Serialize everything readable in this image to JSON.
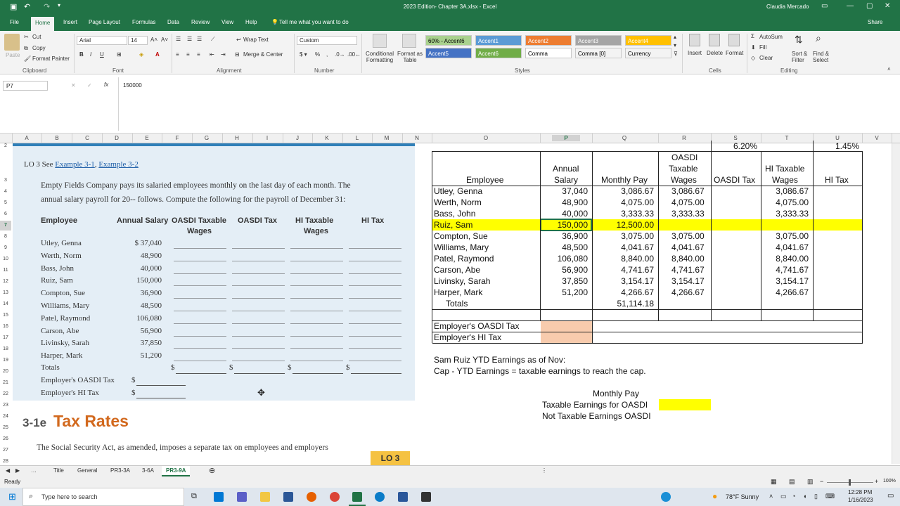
{
  "window": {
    "title": "2023 Edition- Chapter 3A.xlsx  -  Excel",
    "user": "Claudia Mercado"
  },
  "ribbon_tabs": [
    "File",
    "Home",
    "Insert",
    "Page Layout",
    "Formulas",
    "Data",
    "Review",
    "View",
    "Help",
    "Tell me what you want to do"
  ],
  "share_label": "Share",
  "ribbon": {
    "clipboard": {
      "paste": "Paste",
      "cut": "Cut",
      "copy": "Copy",
      "format_painter": "Format Painter",
      "label": "Clipboard"
    },
    "font": {
      "name": "Arial",
      "size": "14",
      "label": "Font"
    },
    "alignment": {
      "wrap": "Wrap Text",
      "merge": "Merge & Center",
      "label": "Alignment"
    },
    "number": {
      "format": "Custom",
      "label": "Number"
    },
    "styles": {
      "conditional": "Conditional Formatting",
      "format_table": "Format as Table",
      "chips": [
        {
          "label": "60% - Accent6",
          "bg": "#a9d18e",
          "fg": "#000000"
        },
        {
          "label": "Accent1",
          "bg": "#5b9bd5",
          "fg": "#ffffff"
        },
        {
          "label": "Accent2",
          "bg": "#ed7d31",
          "fg": "#ffffff"
        },
        {
          "label": "Accent3",
          "bg": "#a5a5a5",
          "fg": "#ffffff"
        },
        {
          "label": "Accent4",
          "bg": "#ffc000",
          "fg": "#ffffff"
        },
        {
          "label": "Accent5",
          "bg": "#4472c4",
          "fg": "#ffffff"
        },
        {
          "label": "Accent6",
          "bg": "#70ad47",
          "fg": "#ffffff"
        },
        {
          "label": "Comma",
          "bg": "#ffffff",
          "fg": "#000000"
        },
        {
          "label": "Comma [0]",
          "bg": "#f3f3f3",
          "fg": "#000000"
        },
        {
          "label": "Currency",
          "bg": "#f3f3f3",
          "fg": "#000000"
        }
      ],
      "label": "Styles"
    },
    "cells": {
      "insert": "Insert",
      "delete": "Delete",
      "format": "Format",
      "label": "Cells"
    },
    "editing": {
      "autosum": "AutoSum",
      "fill": "Fill",
      "clear": "Clear",
      "sort": "Sort & Filter",
      "find": "Find & Select",
      "label": "Editing"
    }
  },
  "formula_bar": {
    "name_box": "P7",
    "value": "150000"
  },
  "columns_left": [
    "A",
    "B",
    "C",
    "D",
    "E",
    "F",
    "G",
    "H",
    "I",
    "J",
    "K",
    "L",
    "M",
    "N"
  ],
  "columns_right": [
    "O",
    "P",
    "Q",
    "R",
    "S",
    "T",
    "U",
    "V"
  ],
  "rows": [
    "2",
    "3",
    "4",
    "5",
    "6",
    "7",
    "8",
    "9",
    "10",
    "11",
    "12",
    "13",
    "14",
    "15",
    "16",
    "17",
    "18",
    "19",
    "20",
    "21",
    "22",
    "23",
    "24",
    "25",
    "26",
    "27",
    "28"
  ],
  "book": {
    "lo_prefix": "LO 3  See ",
    "link1": "Example 3-1",
    "comma": ", ",
    "link2": "Example 3-2",
    "para1": "Empty Fields Company pays its salaried employees monthly on the last day of each month. The",
    "para2": "annual salary payroll for 20-- follows. Compute the following for the payroll of December 31:",
    "headers": {
      "employee": "Employee",
      "annual": "Annual Salary",
      "oasdi_wages1": "OASDI Taxable",
      "oasdi_wages2": "Wages",
      "oasdi_tax": "OASDI Tax",
      "hi_wages1": "HI Taxable",
      "hi_wages2": "Wages",
      "hi_tax": "HI Tax"
    },
    "employees": [
      {
        "name": "Utley, Genna",
        "salary": "$ 37,040"
      },
      {
        "name": "Werth, Norm",
        "salary": "48,900"
      },
      {
        "name": "Bass, John",
        "salary": "40,000"
      },
      {
        "name": "Ruiz, Sam",
        "salary": "150,000"
      },
      {
        "name": "Compton, Sue",
        "salary": "36,900"
      },
      {
        "name": "Williams, Mary",
        "salary": "48,500"
      },
      {
        "name": "Patel, Raymond",
        "salary": "106,080"
      },
      {
        "name": "Carson, Abe",
        "salary": "56,900"
      },
      {
        "name": "Livinsky, Sarah",
        "salary": "37,850"
      },
      {
        "name": "Harper, Mark",
        "salary": "51,200"
      }
    ],
    "totals": "Totals",
    "employer_oasdi": "Employer's OASDI Tax",
    "employer_hi": "Employer's HI Tax",
    "dollar": "$",
    "section_num": "3-1e",
    "section_title": "Tax Rates",
    "body_text": "The Social Security Act, as amended, imposes a separate tax on employees and employers",
    "lo_badge": "LO 3"
  },
  "sheet": {
    "rate_oasdi": "6.20%",
    "rate_hi": "1.45%",
    "headers": {
      "employee": "Employee",
      "annual1": "Annual",
      "annual2": "Salary",
      "monthly": "Monthly Pay",
      "oasdi_w1": "OASDI",
      "oasdi_w2": "Taxable",
      "oasdi_w3": "Wages",
      "oasdi_tax": "OASDI Tax",
      "hi_w1": "HI Taxable",
      "hi_w2": "Wages",
      "hi_tax": "HI Tax"
    },
    "rows": [
      {
        "name": "Utley, Genna",
        "annual": "37,040",
        "monthly": "3,086.67",
        "oasdi": "3,086.67",
        "hi": "3,086.67"
      },
      {
        "name": "Werth, Norm",
        "annual": "48,900",
        "monthly": "4,075.00",
        "oasdi": "4,075.00",
        "hi": "4,075.00"
      },
      {
        "name": "Bass, John",
        "annual": "40,000",
        "monthly": "3,333.33",
        "oasdi": "3,333.33",
        "hi": "3,333.33"
      },
      {
        "name": "Ruiz, Sam",
        "annual": "150,000",
        "monthly": "12,500.00",
        "oasdi": "",
        "hi": ""
      },
      {
        "name": "Compton, Sue",
        "annual": "36,900",
        "monthly": "3,075.00",
        "oasdi": "3,075.00",
        "hi": "3,075.00"
      },
      {
        "name": "Williams, Mary",
        "annual": "48,500",
        "monthly": "4,041.67",
        "oasdi": "4,041.67",
        "hi": "4,041.67"
      },
      {
        "name": "Patel, Raymond",
        "annual": "106,080",
        "monthly": "8,840.00",
        "oasdi": "8,840.00",
        "hi": "8,840.00"
      },
      {
        "name": "Carson, Abe",
        "annual": "56,900",
        "monthly": "4,741.67",
        "oasdi": "4,741.67",
        "hi": "4,741.67"
      },
      {
        "name": "Livinsky, Sarah",
        "annual": "37,850",
        "monthly": "3,154.17",
        "oasdi": "3,154.17",
        "hi": "3,154.17"
      },
      {
        "name": "Harper, Mark",
        "annual": "51,200",
        "monthly": "4,266.67",
        "oasdi": "4,266.67",
        "hi": "4,266.67"
      }
    ],
    "totals_label": "Totals",
    "totals_monthly": "51,114.18",
    "employer_oasdi": "Employer's OASDI Tax",
    "employer_hi": "Employer's HI Tax",
    "note1": "Sam Ruiz YTD Earnings as of Nov:",
    "note2": "Cap   - YTD Earnings   =  taxable earnings to reach the cap.",
    "monthly_pay": "Monthly Pay",
    "taxable_oasdi": "Taxable Earnings for OASDI",
    "not_taxable": "Not Taxable Earnings OASDI",
    "highlight_color": "#ffff00",
    "input_color": "#f8cbad"
  },
  "sheet_tabs": [
    "Title",
    "General",
    "PR3-3A",
    "3-6A",
    "PR3-9A"
  ],
  "active_sheet": "PR3-9A",
  "status": {
    "ready": "Ready",
    "zoom": "100%"
  },
  "taskbar": {
    "search": "Type here to search",
    "weather": "78°F  Sunny",
    "time": "12:28 PM",
    "date": "1/16/2023"
  }
}
